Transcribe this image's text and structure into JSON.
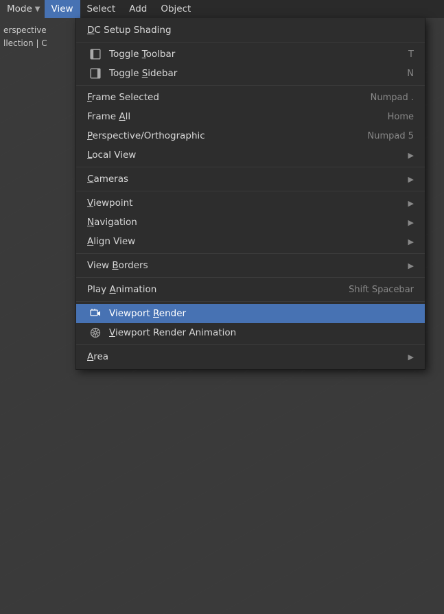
{
  "menuBar": {
    "mode_label": "Mode",
    "mode_arrow": "▼",
    "items": [
      {
        "id": "view",
        "label": "View",
        "active": true
      },
      {
        "id": "select",
        "label": "Select",
        "active": false
      },
      {
        "id": "add",
        "label": "Add",
        "active": false
      },
      {
        "id": "object",
        "label": "Object",
        "active": false
      }
    ]
  },
  "viewportLabels": {
    "line1": "erspective",
    "line2": "llection | C"
  },
  "dropdownMenu": {
    "sections": [
      {
        "items": [
          {
            "id": "dc-setup-shading",
            "label": "DC Setup Shading",
            "shortcut": "",
            "hasArrow": false,
            "hasIcon": false,
            "iconType": null
          }
        ]
      },
      {
        "items": [
          {
            "id": "toggle-toolbar",
            "label": "Toggle Toolbar",
            "shortcut": "T",
            "hasArrow": false,
            "hasIcon": true,
            "iconType": "toolbar"
          },
          {
            "id": "toggle-sidebar",
            "label": "Toggle Sidebar",
            "shortcut": "N",
            "hasArrow": false,
            "hasIcon": true,
            "iconType": "sidebar"
          }
        ]
      },
      {
        "items": [
          {
            "id": "frame-selected",
            "label": "Frame Selected",
            "shortcut": "Numpad .",
            "hasArrow": false,
            "hasIcon": false,
            "iconType": null
          },
          {
            "id": "frame-all",
            "label": "Frame All",
            "shortcut": "Home",
            "hasArrow": false,
            "hasIcon": false,
            "iconType": null
          },
          {
            "id": "perspective-orthographic",
            "label": "Perspective/Orthographic",
            "shortcut": "Numpad 5",
            "hasArrow": false,
            "hasIcon": false,
            "iconType": null
          },
          {
            "id": "local-view",
            "label": "Local View",
            "shortcut": "",
            "hasArrow": true,
            "hasIcon": false,
            "iconType": null
          }
        ]
      },
      {
        "items": [
          {
            "id": "cameras",
            "label": "Cameras",
            "shortcut": "",
            "hasArrow": true,
            "hasIcon": false,
            "iconType": null
          }
        ]
      },
      {
        "items": [
          {
            "id": "viewpoint",
            "label": "Viewpoint",
            "shortcut": "",
            "hasArrow": true,
            "hasIcon": false,
            "iconType": null
          },
          {
            "id": "navigation",
            "label": "Navigation",
            "shortcut": "",
            "hasArrow": true,
            "hasIcon": false,
            "iconType": null
          },
          {
            "id": "align-view",
            "label": "Align View",
            "shortcut": "",
            "hasArrow": true,
            "hasIcon": false,
            "iconType": null
          }
        ]
      },
      {
        "items": [
          {
            "id": "view-borders",
            "label": "View Borders",
            "shortcut": "",
            "hasArrow": true,
            "hasIcon": false,
            "iconType": null
          }
        ]
      },
      {
        "items": [
          {
            "id": "play-animation",
            "label": "Play Animation",
            "shortcut": "Shift Spacebar",
            "hasArrow": false,
            "hasIcon": false,
            "iconType": null
          }
        ]
      },
      {
        "items": [
          {
            "id": "viewport-render",
            "label": "Viewport Render",
            "shortcut": "",
            "hasArrow": false,
            "hasIcon": true,
            "iconType": "camera",
            "highlighted": true
          },
          {
            "id": "viewport-render-animation",
            "label": "Viewport Render Animation",
            "shortcut": "",
            "hasArrow": false,
            "hasIcon": true,
            "iconType": "film",
            "highlighted": false
          }
        ]
      },
      {
        "items": [
          {
            "id": "area",
            "label": "Area",
            "shortcut": "",
            "hasArrow": true,
            "hasIcon": false,
            "iconType": null
          }
        ]
      }
    ],
    "arrows": {
      "right": "▶"
    }
  }
}
